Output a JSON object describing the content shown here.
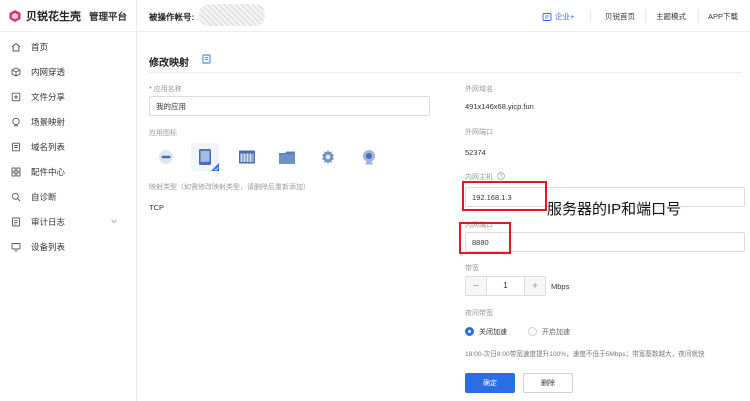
{
  "brand": {
    "name": "贝锐花生壳",
    "sub": "管理平台",
    "color": "#e8305c"
  },
  "sidebar": {
    "items": [
      {
        "label": "首页",
        "icon": "home-icon"
      },
      {
        "label": "内网穿透",
        "icon": "cube-icon"
      },
      {
        "label": "文件分享",
        "icon": "file-share-icon"
      },
      {
        "label": "场景映射",
        "icon": "scene-icon"
      },
      {
        "label": "域名列表",
        "icon": "domain-icon"
      },
      {
        "label": "配件中心",
        "icon": "grid-icon"
      },
      {
        "label": "自诊断",
        "icon": "diagnose-icon"
      },
      {
        "label": "审计日志",
        "icon": "log-icon",
        "has_submenu": true
      },
      {
        "label": "设备列表",
        "icon": "monitor-icon"
      }
    ]
  },
  "topbar": {
    "account_label": "被操作帐号:",
    "enterprise": "企业+",
    "links": [
      "贝锐首页",
      "主题模式",
      "APP下载"
    ]
  },
  "page": {
    "title": "修改映射",
    "app_name_label": "应用名称",
    "app_name_value": "我的应用",
    "app_icon_label": "应用图标",
    "app_icons": [
      "minus-circle-icon",
      "tablet-icon",
      "calendar-icon",
      "folder-icon",
      "gear-icon",
      "webcam-icon"
    ],
    "mapping_type_label": "映射类型（如需修改映射类型，请删除后重新添加）",
    "mapping_type_value": "TCP",
    "ext_domain_label": "外网域名",
    "ext_domain_value": "491x146x68.yicp.fun",
    "ext_port_label": "外网端口",
    "ext_port_value": "52374",
    "int_host_label": "内网主机",
    "int_host_value": "192.168.1.3",
    "int_port_label": "内网端口",
    "int_port_value": "8880",
    "bandwidth_label": "带宽",
    "bandwidth_value": "1",
    "bandwidth_unit": "Mbps",
    "night_label": "夜间带宽",
    "night_off": "关闭加速",
    "night_on": "开启加速",
    "night_note": "18:00-次日8:00带宽速度提升100%，速度不低于5Mbps；带宽基数越大，夜间就快",
    "confirm": "确定",
    "delete": "删除"
  },
  "annotation": {
    "text": "服务器的IP和端口号",
    "color": "#e01a1a"
  },
  "accent": "#2b6de5"
}
